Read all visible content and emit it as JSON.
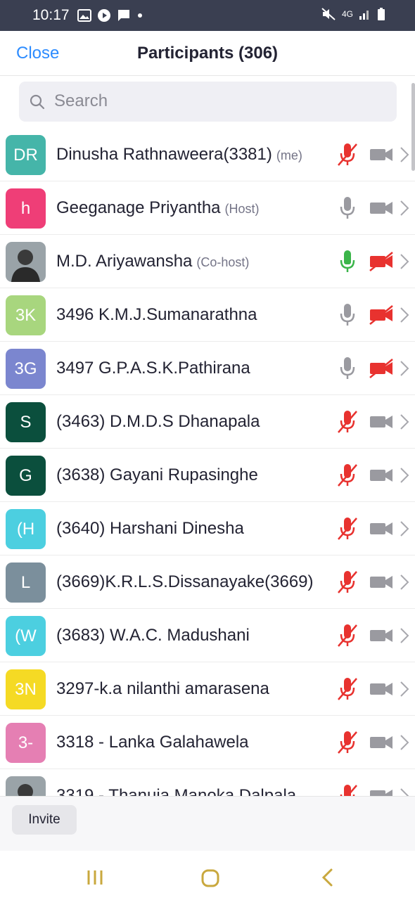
{
  "status_bar": {
    "time": "10:17",
    "network": "4G"
  },
  "header": {
    "close_label": "Close",
    "title": "Participants (306)"
  },
  "search": {
    "placeholder": "Search"
  },
  "participants": [
    {
      "initials": "DR",
      "avatar_color": "#45b5a9",
      "name": "Dinusha Rathnaweera(3381)",
      "tag": "(me)",
      "mic": "muted",
      "video": "off"
    },
    {
      "initials": "h",
      "avatar_color": "#ef3e77",
      "name": "Geeganage Priyantha",
      "tag": "(Host)",
      "mic": "unmuted",
      "video": "off"
    },
    {
      "initials": "",
      "avatar_photo": true,
      "name": "M.D. Ariyawansha",
      "tag": "(Co-host)",
      "mic": "active",
      "video": "disabled"
    },
    {
      "initials": "3K",
      "avatar_color": "#a8d67e",
      "name": "3496 K.M.J.Sumanarathna",
      "tag": "",
      "mic": "unmuted",
      "video": "disabled"
    },
    {
      "initials": "3G",
      "avatar_color": "#7b86cf",
      "name": "3497 G.P.A.S.K.Pathirana",
      "tag": "",
      "mic": "unmuted",
      "video": "disabled"
    },
    {
      "initials": "S",
      "avatar_color": "#0b4f3d",
      "name": "(3463) D.M.D.S Dhanapala",
      "tag": "",
      "mic": "muted",
      "video": "off"
    },
    {
      "initials": "G",
      "avatar_color": "#0b4f3d",
      "name": "(3638) Gayani Rupasinghe",
      "tag": "",
      "mic": "muted",
      "video": "off"
    },
    {
      "initials": "(H",
      "avatar_color": "#4ccfe0",
      "name": "(3640) Harshani Dinesha",
      "tag": "",
      "mic": "muted",
      "video": "off"
    },
    {
      "initials": "L",
      "avatar_color": "#7b8f9c",
      "name": "(3669)K.R.L.S.Dissanayake(3669)",
      "tag": "",
      "mic": "muted",
      "video": "off"
    },
    {
      "initials": "(W",
      "avatar_color": "#4ccfe0",
      "name": "(3683) W.A.C. Madushani",
      "tag": "",
      "mic": "muted",
      "video": "off"
    },
    {
      "initials": "3N",
      "avatar_color": "#f5da24",
      "name": "3297-k.a nilanthi amarasena",
      "tag": "",
      "mic": "muted",
      "video": "off"
    },
    {
      "initials": "3-",
      "avatar_color": "#e57fb3",
      "name": "3318 - Lanka Galahawela",
      "tag": "",
      "mic": "muted",
      "video": "off"
    },
    {
      "initials": "",
      "avatar_photo": true,
      "name": "3319 - Thanuja Manoka Dalpala",
      "tag": "",
      "mic": "muted",
      "video": "off"
    }
  ],
  "footer": {
    "invite_label": "Invite"
  },
  "colors": {
    "accent": "#2d8cff",
    "muted_red": "#e8322f",
    "active_green": "#3bb54a",
    "icon_gray": "#9a9aa0"
  }
}
